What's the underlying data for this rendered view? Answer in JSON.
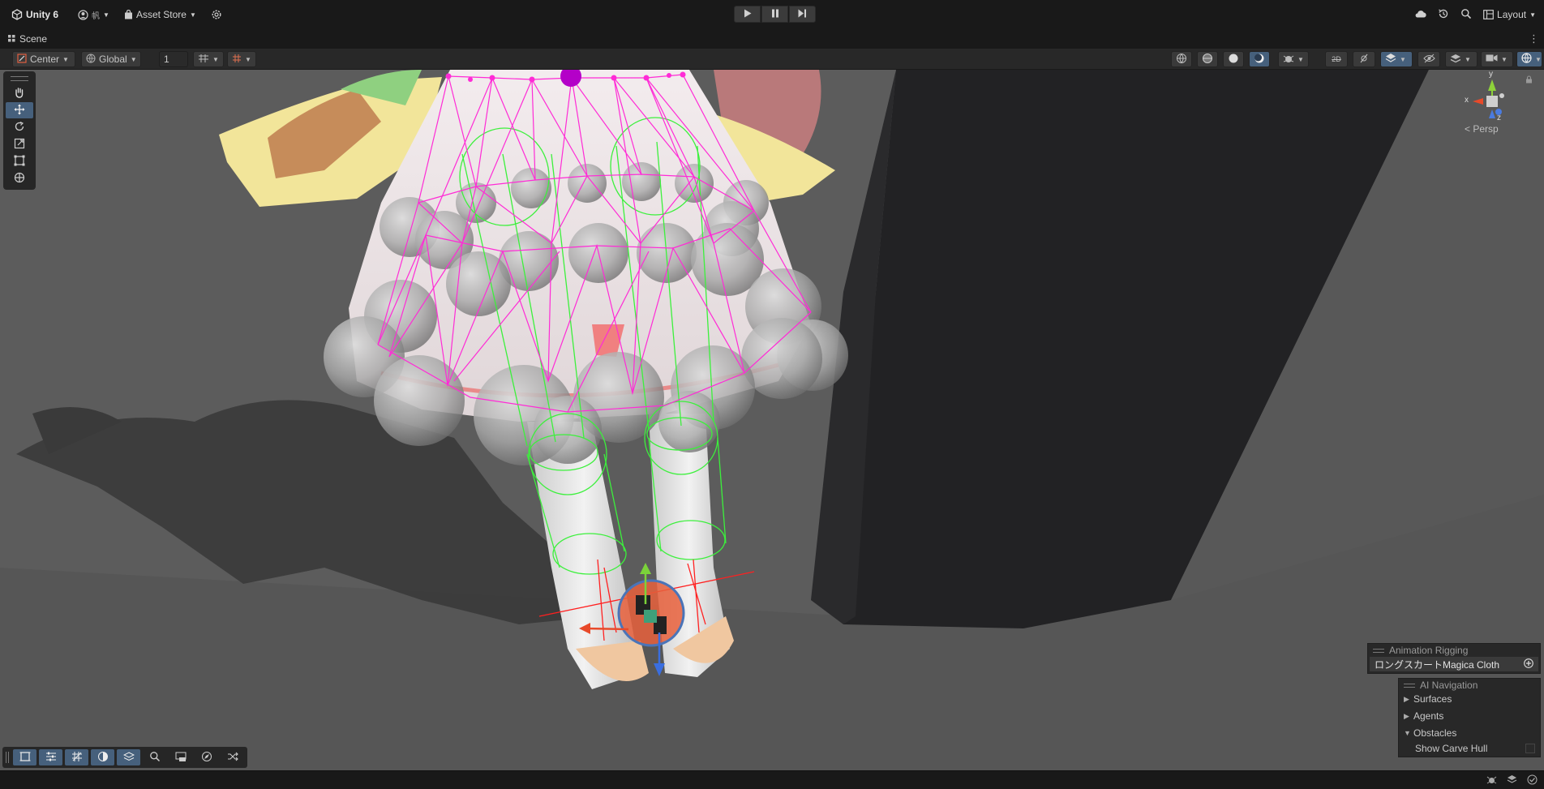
{
  "titlebar": {
    "app_name": "Unity 6",
    "account_label": "帆",
    "asset_store_label": "Asset Store",
    "layout_label": "Layout",
    "icons": [
      "unity-logo-icon",
      "account-icon",
      "cloud-icon",
      "history-icon",
      "search-icon",
      "layout-icon",
      "settings-gear-icon"
    ]
  },
  "playmode": {
    "buttons": [
      "play",
      "pause",
      "step"
    ]
  },
  "tabs": [
    {
      "label": "Scene",
      "icon": "grid-icon"
    }
  ],
  "scene_toolbar": {
    "pivot_label": "Center",
    "space_label": "Global",
    "grid_size_value": "1"
  },
  "tools": [
    "hand",
    "move",
    "rotate",
    "scale",
    "rect",
    "transform"
  ],
  "active_tool": "move",
  "orientation_gizmo": {
    "projection_label": "Persp",
    "axis_labels": {
      "y": "y",
      "x": "x",
      "z": "z"
    }
  },
  "overlays": {
    "animation_rigging": {
      "title": "Animation Rigging",
      "field_value": "ロングスカートMagica Cloth"
    },
    "ai_navigation": {
      "title": "AI Navigation",
      "items": [
        {
          "label": "Surfaces",
          "expanded": false
        },
        {
          "label": "Agents",
          "expanded": false
        },
        {
          "label": "Obstacles",
          "expanded": true
        }
      ],
      "option_label": "Show Carve Hull"
    }
  },
  "colors": {
    "accent": "#46607c",
    "bg": "#191919",
    "toolbar": "#282828",
    "magenta": "#ff2bd6",
    "green": "#3cf03c"
  }
}
